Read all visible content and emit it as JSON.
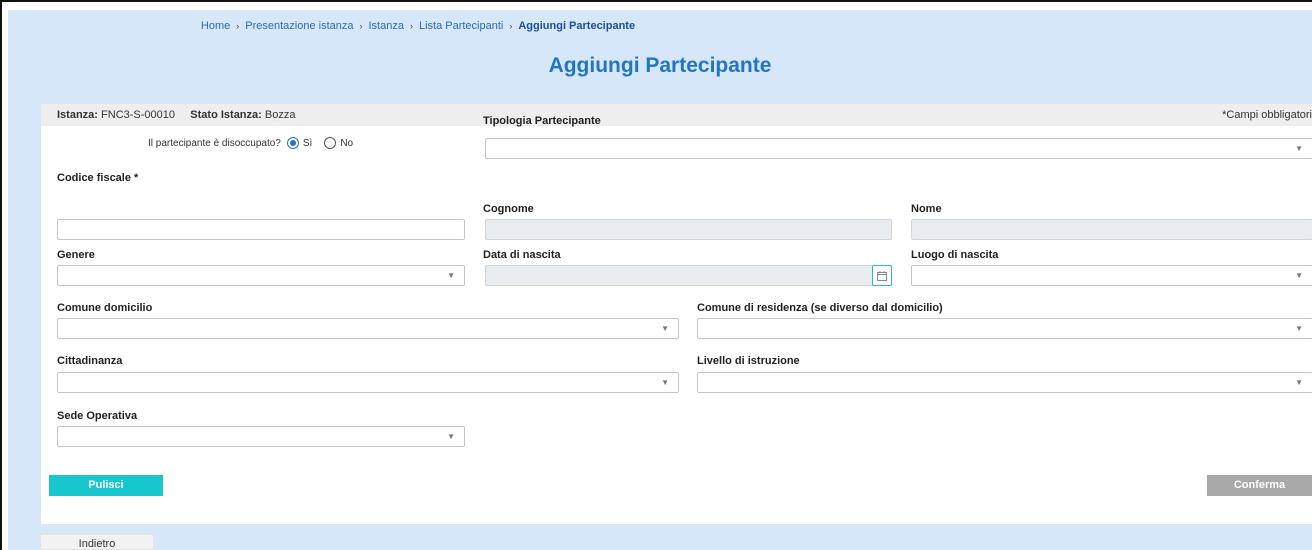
{
  "breadcrumb": {
    "items": [
      "Home",
      "Presentazione istanza",
      "Istanza",
      "Lista Partecipanti"
    ],
    "current": "Aggiungi Partecipante",
    "separator": "›"
  },
  "page_title": "Aggiungi Partecipante",
  "info_bar": {
    "istanza_label": "Istanza:",
    "istanza_value": "FNC3-S-00010",
    "stato_label": "Stato Istanza:",
    "stato_value": "Bozza",
    "required_note": "*Campi obbligatori"
  },
  "disoccupato": {
    "question": "Il partecipante è disoccupato?",
    "options": [
      "Sì",
      "No"
    ],
    "selected": "Sì"
  },
  "fields": {
    "tipologia_partecipante": {
      "label": "Tipologia Partecipante",
      "value": ""
    },
    "codice_fiscale": {
      "label": "Codice fiscale *",
      "value": ""
    },
    "cognome": {
      "label": "Cognome",
      "value": ""
    },
    "nome": {
      "label": "Nome",
      "value": ""
    },
    "genere": {
      "label": "Genere",
      "value": ""
    },
    "data_nascita": {
      "label": "Data di nascita",
      "value": ""
    },
    "luogo_nascita": {
      "label": "Luogo di nascita",
      "value": ""
    },
    "comune_domicilio": {
      "label": "Comune domicilio",
      "value": ""
    },
    "comune_residenza": {
      "label": "Comune di residenza (se diverso dal domicilio)",
      "value": ""
    },
    "cittadinanza": {
      "label": "Cittadinanza",
      "value": ""
    },
    "livello_istruzione": {
      "label": "Livello di istruzione",
      "value": ""
    },
    "sede_operativa": {
      "label": "Sede Operativa",
      "value": ""
    }
  },
  "buttons": {
    "pulisci": "Pulisci",
    "conferma": "Conferma",
    "indietro": "Indietro"
  },
  "icons": {
    "dropdown": "chevron-down-icon",
    "calendar": "calendar-icon"
  },
  "colors": {
    "page_bg": "#d6e7fa",
    "title": "#2175c9",
    "pulisci_bg": "#18c6d0",
    "conferma_bg": "#a8a8a8"
  }
}
